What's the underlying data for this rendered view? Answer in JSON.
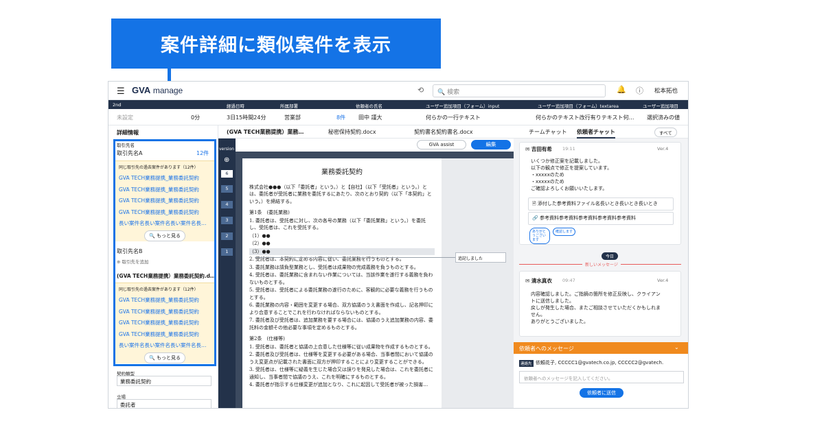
{
  "banner": {
    "text": "案件詳細に類似案件を表示"
  },
  "topbar": {
    "menu_icon": "☰",
    "logo_main": "GVA",
    "logo_sub": "manage",
    "search_placeholder": "検索",
    "user_name": "松本拓也"
  },
  "header_cols": [
    "2nd",
    "経過日時",
    "所属部署",
    "依頼者の氏名",
    "ユーザー追加項目（フォーム）input",
    "ユーザー追加項目（フォーム）textarea",
    "ユーザー追加項目"
  ],
  "header_values": {
    "status": "未設定",
    "count": "0分",
    "elapsed": "3日15時間24分",
    "dept": "営業部",
    "dept_count": "8件",
    "requester": "田中 謹大",
    "input_val": "何らかの一行テキスト",
    "textarea_val": "何らかのテキスト改行有りテキスト何…",
    "select_val": "選択済みの値"
  },
  "left": {
    "section_title": "詳細情報",
    "partner_label": "取引先名",
    "partnerA": "取引先名A",
    "partnerA_count": "12件",
    "notice1": "同じ取引先の過去案件があります（12件）",
    "links1": [
      "GVA TECH業務提携_業務委託契約",
      "GVA TECH業務提携_業務委託契約",
      "GVA TECH業務提携_業務委託契約",
      "GVA TECH業務提携_業務委託契約",
      "長い案件名長い案件名長い案件名長…"
    ],
    "more1": "もっと見る",
    "partnerB": "取引先名B",
    "add_partner": "取引先を追加",
    "case_title": "(GVA TECH業務提携）業務委託契約.d…",
    "notice2": "同じ取引先の過去案件があります（12件）",
    "links2": [
      "GVA TECH業務提携_業務委託契約",
      "GVA TECH業務提携_業務委託契約",
      "GVA TECH業務提携_業務委託契約",
      "GVA TECH業務提携_業務委託契約",
      "長い案件名長い案件名長い案件名長…"
    ],
    "more2": "もっと見る",
    "contract_type_label": "契約類型",
    "contract_type_value": "業務委託契約",
    "position_label": "立場",
    "position_value": "委託者"
  },
  "doc_tabs": [
    "(GVA TECH業務提携）業務…",
    "秘密保持契約.docx",
    "契約書名契約書名.docx"
  ],
  "sidebar": {
    "label": "version",
    "versions": [
      "6",
      "5",
      "4",
      "3",
      "2",
      "1"
    ]
  },
  "toolbar": {
    "assist": "GVA assist",
    "edit": "編集"
  },
  "document": {
    "title": "業務委託契約",
    "intro": "株式会社●●●（以下「委託者」という。）と【自社】（以下「受託者」という。）とは、委託者が受託者に業務を委託するにあたり、次のとおり契約（以下「本契約」という。）を締結する。",
    "art1_title": "第1条　(委託業務)",
    "art1": [
      "1. 委託者は、受託者に対し、次の各号の業務（以下「委託業務」という。）を委託し、受託者は、これを受託する。",
      "（1）●●",
      "（2）●●",
      "（3）●●",
      "2. 受託者は、本契約に定める内容に従い、委託業務を行うものとする。",
      "3. 委託業務は請負型業務とし、受託者は成果物の完成義務を負うものとする。",
      "4. 受託者は、委託業務に含まれない作業については、当該作業を遂行する義務を負わないものとする。",
      "5. 受託者は、受託者による委託業務の遂行のために、客観的に必要な義務を行うものとする。",
      "6. 委託業務の内容・範囲を変更する場合、双方協議のうえ書面を作成し、記名押印により合意することでこれを行わなければならないものとする。",
      "7. 委託者及び受託者は、追加業務を要する場合には、協議のうえ追加業務の内容、委託料の金額その他必要な事項を定めるものとする。"
    ],
    "art2_title": "第2条　(仕様等)",
    "art2": [
      "1. 受託者は、委託者と協議の上合意した仕様等に従い成果物を作成するものとする。",
      "2. 委託者及び受託者は、仕様等を変更する必要がある場合、当事者間において協議のうえ変更点が記載された書面に双方が押印することにより変更することができる。",
      "3. 受託者は、仕様等に疑義を生じた場合又は誤りを発見した場合は、これを委託者に通知し、当事者間で協議のうえ、これを明確にするものとする。",
      "4. 委託者が指示する仕様変更が追加となり、これに起因して受託者が被った損害…"
    ],
    "comment": "追記しました"
  },
  "chat": {
    "tab1": "チームチャット",
    "tab2": "依頼者チャット",
    "all": "すべて",
    "msg1_name": "吉田有希",
    "msg1_time": "19:11",
    "msg1_ver": "Ver.4",
    "msg1_body": [
      "いくつか修正案を記載しました。",
      "以下の観点で修正を提案しています。",
      "・xxxxxのため",
      "・xxxxxのため",
      "ご確認よろしくお願いいたします。"
    ],
    "attach1": "添付した参考資料ファイル名長いとき長いとき長いとき",
    "attach2": "参考資料参考資料参考資料参考資料参考資料",
    "reaction1": "ありがとうございます",
    "reaction2": "確認します",
    "today": "今日",
    "new_msg": "新しいメッセージ",
    "msg2_name": "清水真衣",
    "msg2_time": "09:47",
    "msg2_ver": "Ver.4",
    "msg2_body": [
      "内容確認しました。ご指摘の箇所を修正反映し、クライアン",
      "トに送信しました。",
      "戻しが発生した場合、またご相談させていただくかもしれま",
      "せん。",
      "ありがとうございました。"
    ],
    "to_client": "依頼者へのメッセージ",
    "contact_badge": "連絡先",
    "contact": "依頼花子, CCCCC1@gvatech.co.jp, CCCCC2@gvatech.",
    "input_placeholder": "依頼者へのメッセージを記入してください。",
    "send": "依頼者に送信"
  }
}
